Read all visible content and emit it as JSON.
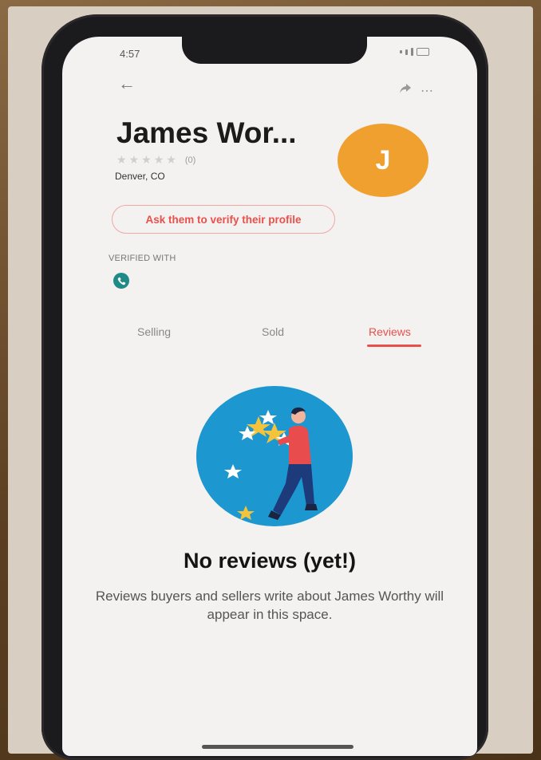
{
  "status_bar": {
    "time": "4:57"
  },
  "header": {
    "back_icon": "back-arrow-icon",
    "share_icon": "share-icon",
    "more_icon": "more-icon"
  },
  "profile": {
    "name": "James Wor...",
    "rating_count": "(0)",
    "location": "Denver, CO",
    "avatar_initial": "J",
    "verify_button_label": "Ask them to verify their profile",
    "verified_with_label": "VERIFIED WITH"
  },
  "tabs": [
    {
      "label": "Selling"
    },
    {
      "label": "Sold"
    },
    {
      "label": "Reviews"
    }
  ],
  "empty_state": {
    "title": "No reviews (yet!)",
    "description": "Reviews buyers and sellers write about James Worthy will appear in this space."
  },
  "colors": {
    "accent": "#e9504b",
    "avatar_bg": "#f0a02e",
    "verified_badge": "#1f8a86",
    "illustration_bg": "#1d97cf"
  }
}
